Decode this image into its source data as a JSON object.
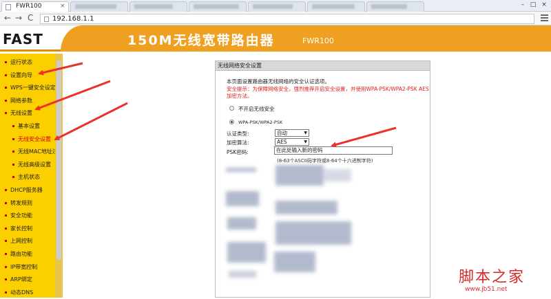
{
  "browser": {
    "tab_title": "FWR100",
    "tab_close": "×",
    "back": "←",
    "forward": "→",
    "reload": "C",
    "url": "192.168.1.1",
    "window_buttons": [
      "–",
      "□",
      "×"
    ]
  },
  "header": {
    "logo": "FAST",
    "title": "150M无线宽带路由器",
    "model": "FWR100"
  },
  "sidebar": {
    "items": [
      {
        "label": "运行状态",
        "indent": 0,
        "active": false
      },
      {
        "label": "设置向导",
        "indent": 0,
        "active": false
      },
      {
        "label": "WPS一键安全设定",
        "indent": 0,
        "active": false
      },
      {
        "label": "网络参数",
        "indent": 0,
        "active": false
      },
      {
        "label": "无线设置",
        "indent": 0,
        "active": false
      },
      {
        "label": "基本设置",
        "indent": 1,
        "active": false
      },
      {
        "label": "无线安全设置",
        "indent": 1,
        "active": true
      },
      {
        "label": "无线MAC地址过滤",
        "indent": 1,
        "active": false
      },
      {
        "label": "无线高级设置",
        "indent": 1,
        "active": false
      },
      {
        "label": "主机状态",
        "indent": 1,
        "active": false
      },
      {
        "label": "DHCP服务器",
        "indent": 0,
        "active": false
      },
      {
        "label": "转发规则",
        "indent": 0,
        "active": false
      },
      {
        "label": "安全功能",
        "indent": 0,
        "active": false
      },
      {
        "label": "家长控制",
        "indent": 0,
        "active": false
      },
      {
        "label": "上网控制",
        "indent": 0,
        "active": false
      },
      {
        "label": "路由功能",
        "indent": 0,
        "active": false
      },
      {
        "label": "IP带宽控制",
        "indent": 0,
        "active": false
      },
      {
        "label": "ARP绑定",
        "indent": 0,
        "active": false
      },
      {
        "label": "动态DNS",
        "indent": 0,
        "active": false
      }
    ]
  },
  "panel": {
    "title": "无线网络安全设置",
    "description": "本页面设置路由器无线网络的安全认证选项。",
    "warning_line1": "安全提示：为保障网络安全，强烈推荐开启安全设置，并使用WPA-PSK/WPA2-PSK AES",
    "warning_line2": "加密方法。",
    "option_off": "不开启无线安全",
    "option_wpa": "WPA-PSK/WPA2-PSK",
    "auth_label": "认证类型:",
    "auth_value": "自动",
    "enc_label": "加密算法:",
    "enc_value": "AES",
    "psk_label": "PSK密码:",
    "psk_value": "在此处输入新的密码",
    "psk_hint": "(8-63个ASCII码字符或8-64个十六进制字符)"
  },
  "watermark": {
    "site_cn": "脚本之家",
    "site_url": "www.jb51.net"
  },
  "colors": {
    "banner": "#f0a021",
    "sidebar": "#fccf00",
    "arrow": "#e8322a"
  }
}
